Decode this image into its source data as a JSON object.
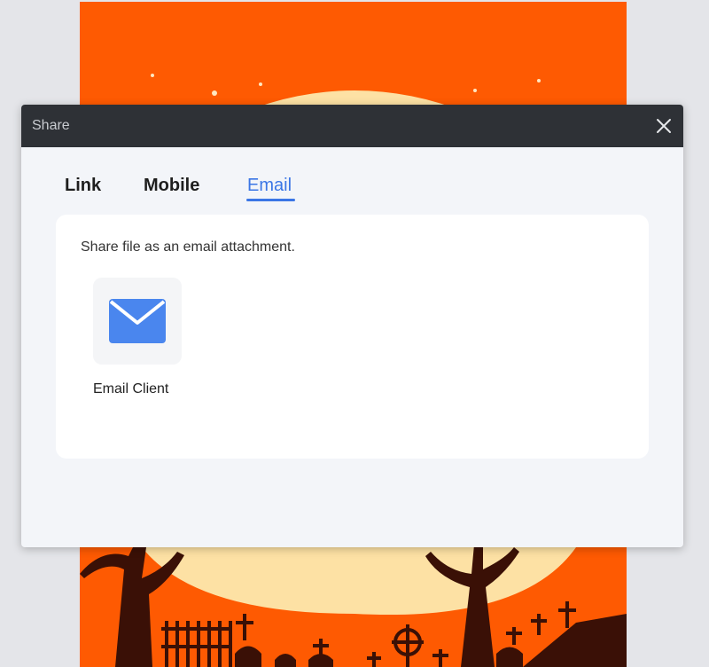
{
  "dialog": {
    "title": "Share",
    "close_icon": "close-icon"
  },
  "tabs": [
    {
      "label": "Link",
      "active": false
    },
    {
      "label": "Mobile",
      "active": false
    },
    {
      "label": "Email",
      "active": true
    }
  ],
  "email_panel": {
    "description": "Share file as an email attachment.",
    "options": [
      {
        "label": "Email Client",
        "icon": "envelope-icon"
      }
    ]
  },
  "colors": {
    "accent": "#3b76e5",
    "titlebar": "#2e3136",
    "background_page": "#fe5a02"
  }
}
